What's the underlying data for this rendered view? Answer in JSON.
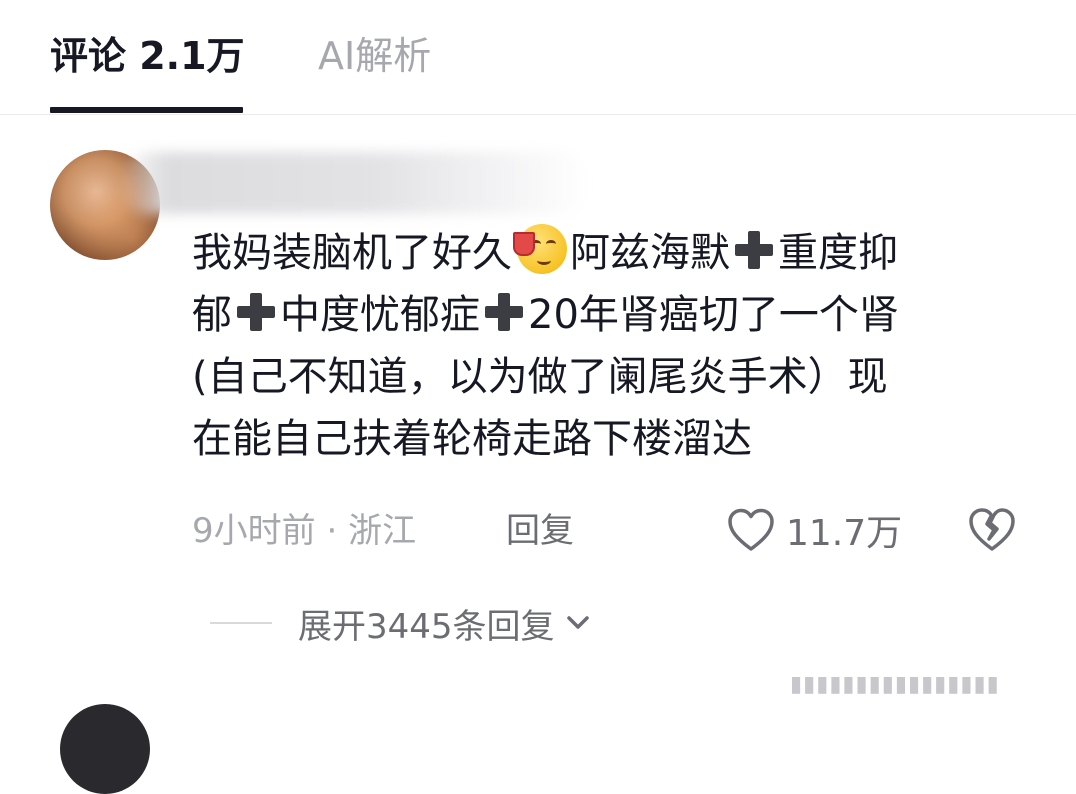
{
  "tabs": {
    "comments": "评论 2.1万",
    "ai": "AI解析"
  },
  "comment": {
    "lines": [
      [
        "我妈装脑机了好久",
        "阿兹海默",
        "重度抑"
      ],
      [
        "郁",
        "中度忧郁症",
        "20年肾癌切了一个肾"
      ],
      [
        "(自己不知道，以为做了阑尾炎手术）现"
      ],
      [
        "在能自己扶着轮椅走路下楼溜达"
      ]
    ],
    "emoji": "drinking-face-emoji",
    "time": "9小时前",
    "location": "浙江",
    "meta_separator": "·",
    "reply_label": "回复",
    "like_count": "11.7万"
  },
  "expand": {
    "label": "展开3445条回复"
  },
  "colors": {
    "text": "#161823",
    "secondary": "#a7a8ad",
    "action": "#6c6d73"
  }
}
